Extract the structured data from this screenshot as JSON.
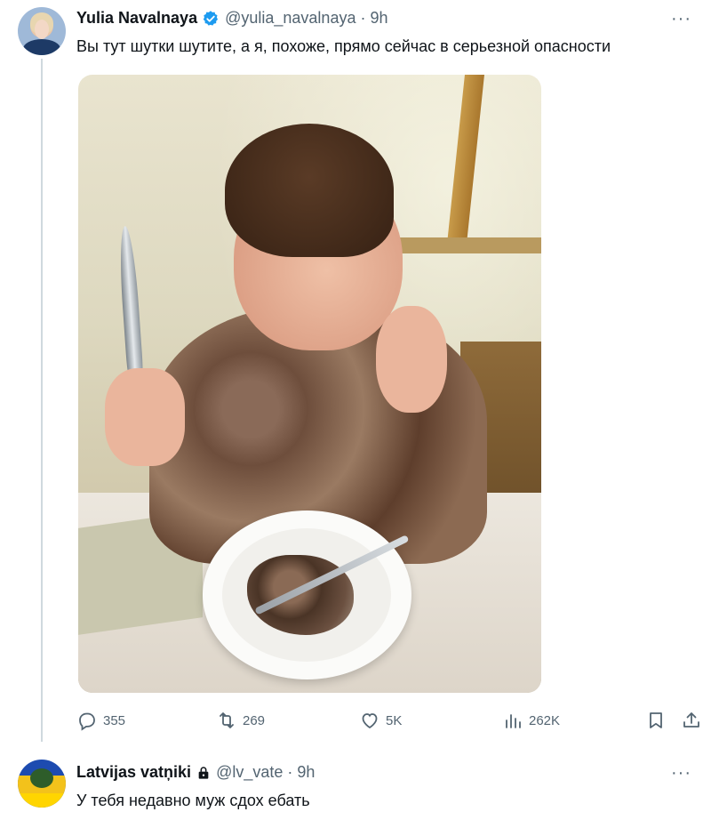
{
  "tweet": {
    "author_name": "Yulia Navalnaya",
    "handle": "@yulia_navalnaya",
    "separator": "·",
    "time": "9h",
    "more": "···",
    "text": "Вы тут шутки шутите, а я, похоже, прямо сейчас в серьезной опасности",
    "verified_color": "#1d9bf0",
    "stats": {
      "replies": "355",
      "retweets": "269",
      "likes": "5K",
      "views": "262K"
    }
  },
  "reply": {
    "author_name": "Latvijas vatņiki",
    "handle": "@lv_vate",
    "separator": "·",
    "time": "9h",
    "more": "···",
    "text": "У тебя недавно муж сдох ебать"
  },
  "icons": {
    "reply": "reply-icon",
    "retweet": "retweet-icon",
    "like": "heart-icon",
    "views": "views-chart-icon",
    "bookmark": "bookmark-icon",
    "share": "share-icon",
    "verified": "verified-badge-icon",
    "lock": "lock-icon"
  },
  "colors": {
    "text": "#0f1419",
    "secondary": "#536471",
    "thread_line": "#cfd9de"
  }
}
